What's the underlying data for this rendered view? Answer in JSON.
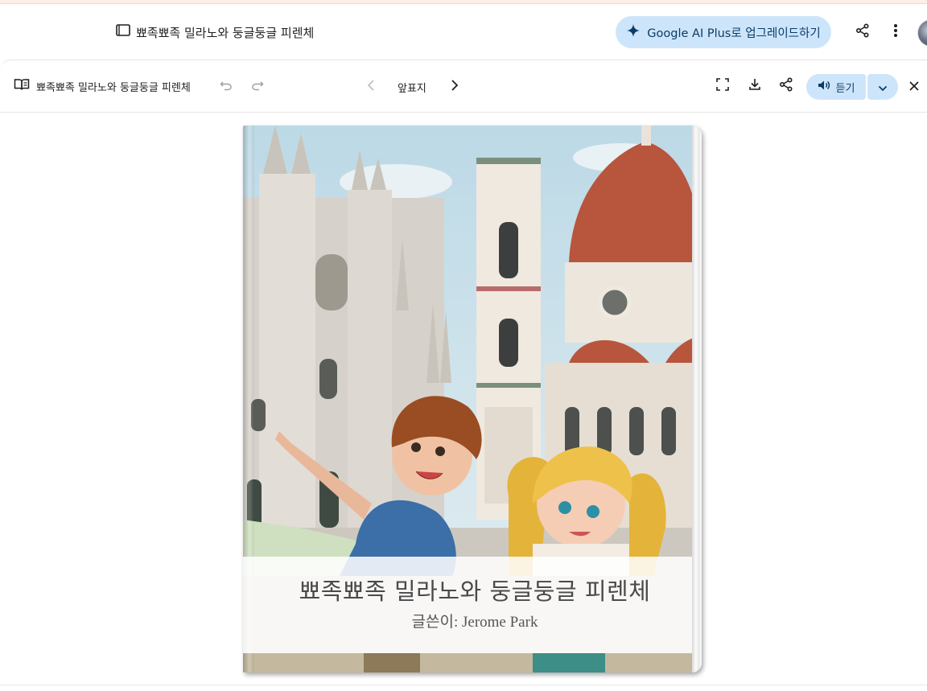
{
  "header": {
    "doc_title": "뾰족뾰족 밀라노와 둥글둥글 피렌체",
    "upgrade_label": "Google AI Plus로 업그레이드하기",
    "icons": [
      "book-outline-icon",
      "sparkle-icon",
      "share-icon",
      "more-vert-icon",
      "avatar"
    ]
  },
  "toolbar": {
    "book_title": "뾰족뾰족 밀라노와 둥글둥글 피렌체",
    "page_label": "앞표지",
    "listen_label": "듣기",
    "icons": [
      "open-book-icon",
      "undo-icon",
      "redo-icon",
      "chevron-left-icon",
      "chevron-right-icon",
      "fullscreen-icon",
      "download-icon",
      "share-icon",
      "speaker-icon",
      "chevron-down-icon",
      "close-icon"
    ]
  },
  "cover": {
    "title": "뾰족뾰족 밀라노와 둥글둥글 피렌체",
    "author": "글쓴이: Jerome Park",
    "illustration": "Milan Cathedral and Florence Duomo with two children"
  },
  "colors": {
    "accent_button_bg": "#cde5fb",
    "accent_button_text": "#0b3c66",
    "sky": "#cfe3ec",
    "dome": "#b8553d"
  }
}
